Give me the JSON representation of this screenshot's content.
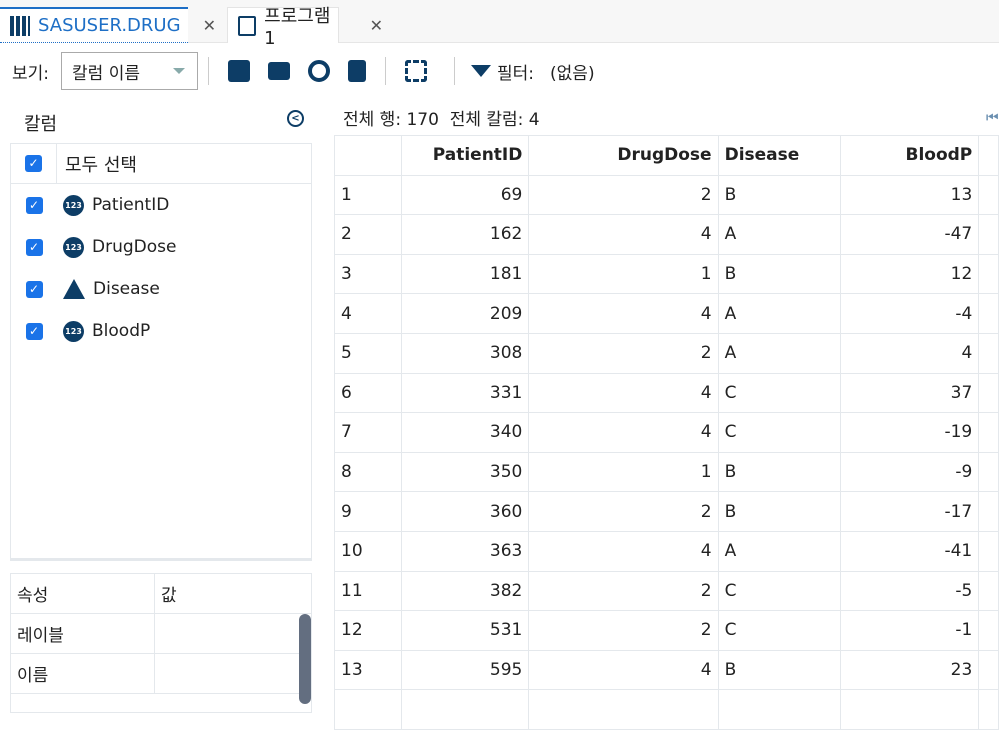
{
  "tabs": [
    {
      "label": "SASUSER.DRUG",
      "icon": "table-icon"
    },
    {
      "label": "프로그램 1",
      "icon": "program-icon"
    }
  ],
  "toolbar": {
    "view_label": "보기:",
    "view_select": "칼럼 이름",
    "filter_label": "필터:",
    "filter_value": "(없음)"
  },
  "left": {
    "title": "칼럼",
    "select_all": "모두 선택",
    "columns": [
      {
        "name": "PatientID",
        "type": "123"
      },
      {
        "name": "DrugDose",
        "type": "123"
      },
      {
        "name": "Disease",
        "type": "A"
      },
      {
        "name": "BloodP",
        "type": "123"
      }
    ]
  },
  "props": {
    "headers": [
      "속성",
      "값"
    ],
    "rows": [
      "레이블",
      "이름"
    ]
  },
  "summary": "전체 행: 170  전체 칼럼: 4",
  "grid": {
    "headers": [
      "",
      "PatientID",
      "DrugDose",
      "Disease",
      "BloodP"
    ],
    "rows": [
      [
        "1",
        "69",
        "2",
        "B",
        "13"
      ],
      [
        "2",
        "162",
        "4",
        "A",
        "-47"
      ],
      [
        "3",
        "181",
        "1",
        "B",
        "12"
      ],
      [
        "4",
        "209",
        "4",
        "A",
        "-4"
      ],
      [
        "5",
        "308",
        "2",
        "A",
        "4"
      ],
      [
        "6",
        "331",
        "4",
        "C",
        "37"
      ],
      [
        "7",
        "340",
        "4",
        "C",
        "-19"
      ],
      [
        "8",
        "350",
        "1",
        "B",
        "-9"
      ],
      [
        "9",
        "360",
        "2",
        "B",
        "-17"
      ],
      [
        "10",
        "363",
        "4",
        "A",
        "-41"
      ],
      [
        "11",
        "382",
        "2",
        "C",
        "-5"
      ],
      [
        "12",
        "531",
        "2",
        "C",
        "-1"
      ],
      [
        "13",
        "595",
        "4",
        "B",
        "23"
      ],
      [
        "",
        "",
        "",
        "",
        ""
      ]
    ]
  }
}
